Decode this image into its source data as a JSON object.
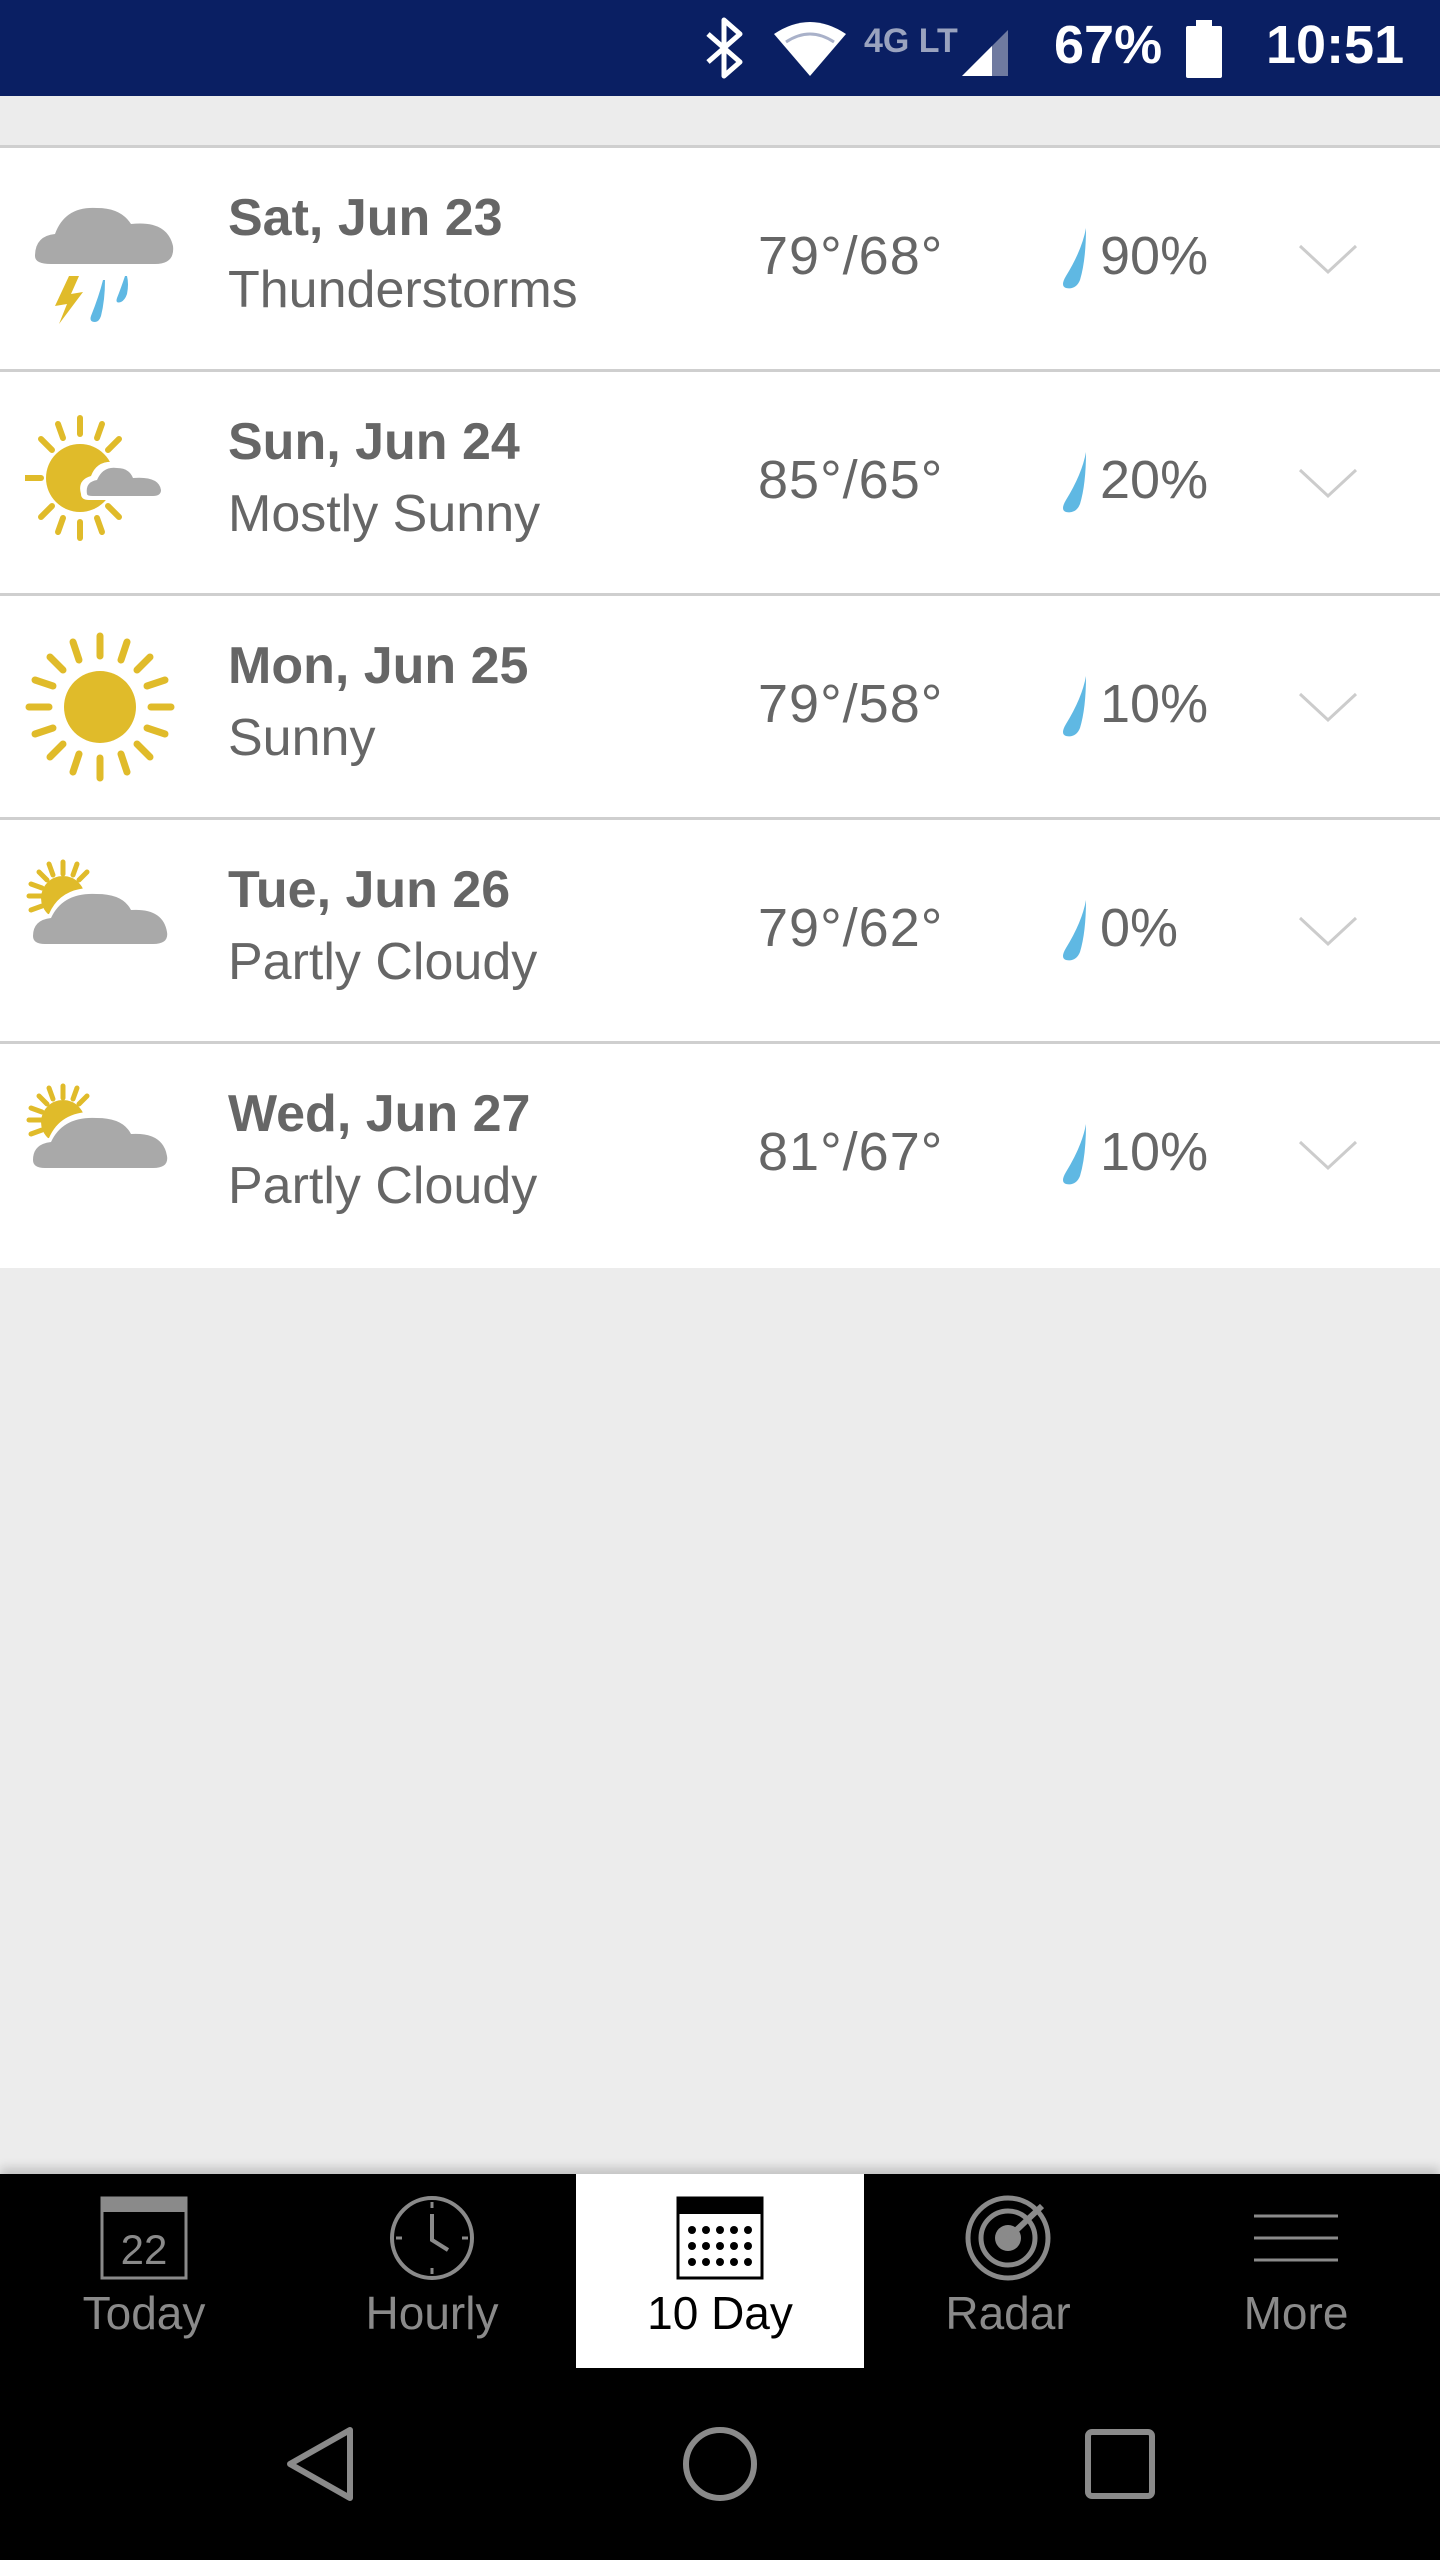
{
  "status_bar": {
    "network": "4G LTE",
    "battery": "67%",
    "time": "10:51",
    "icons": [
      "bluetooth-icon",
      "wifi-icon",
      "lte-icon",
      "signal-icon",
      "battery-icon"
    ]
  },
  "forecast": [
    {
      "date": "Sat, Jun 23",
      "condition": "Thunderstorms",
      "temps": "79°/68°",
      "precip": "90%",
      "icon": "thunderstorm-icon"
    },
    {
      "date": "Sun, Jun 24",
      "condition": "Mostly Sunny",
      "temps": "85°/65°",
      "precip": "20%",
      "icon": "mostly-sunny-icon"
    },
    {
      "date": "Mon, Jun 25",
      "condition": "Sunny",
      "temps": "79°/58°",
      "precip": "10%",
      "icon": "sunny-icon"
    },
    {
      "date": "Tue, Jun 26",
      "condition": "Partly Cloudy",
      "temps": "79°/62°",
      "precip": "0%",
      "icon": "partly-cloudy-icon"
    },
    {
      "date": "Wed, Jun 27",
      "condition": "Partly Cloudy",
      "temps": "81°/67°",
      "precip": "10%",
      "icon": "partly-cloudy-icon"
    }
  ],
  "tabs": [
    {
      "label": "Today",
      "calendar_day": "22",
      "icon": "calendar-day-icon",
      "active": false
    },
    {
      "label": "Hourly",
      "icon": "clock-icon",
      "active": false
    },
    {
      "label": "10 Day",
      "icon": "calendar-grid-icon",
      "active": true
    },
    {
      "label": "Radar",
      "icon": "radar-icon",
      "active": false
    },
    {
      "label": "More",
      "icon": "menu-icon",
      "active": false
    }
  ],
  "colors": {
    "status_bar": "#0a1f63",
    "sun": "#e0bb2a",
    "cloud": "#a9a9a9",
    "rain": "#5fb8e3",
    "text": "#666666",
    "background": "#ececec"
  }
}
